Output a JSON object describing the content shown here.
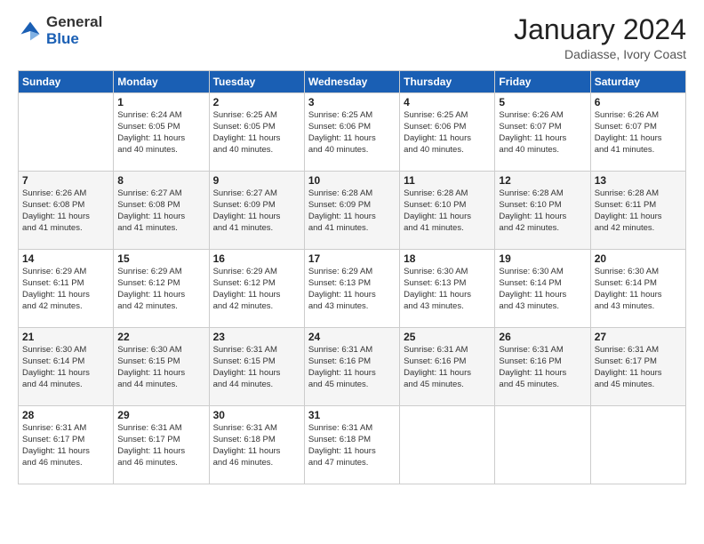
{
  "logo": {
    "general": "General",
    "blue": "Blue"
  },
  "title": "January 2024",
  "location": "Dadiasse, Ivory Coast",
  "days_header": [
    "Sunday",
    "Monday",
    "Tuesday",
    "Wednesday",
    "Thursday",
    "Friday",
    "Saturday"
  ],
  "weeks": [
    [
      {
        "day": "",
        "info": ""
      },
      {
        "day": "1",
        "info": "Sunrise: 6:24 AM\nSunset: 6:05 PM\nDaylight: 11 hours\nand 40 minutes."
      },
      {
        "day": "2",
        "info": "Sunrise: 6:25 AM\nSunset: 6:05 PM\nDaylight: 11 hours\nand 40 minutes."
      },
      {
        "day": "3",
        "info": "Sunrise: 6:25 AM\nSunset: 6:06 PM\nDaylight: 11 hours\nand 40 minutes."
      },
      {
        "day": "4",
        "info": "Sunrise: 6:25 AM\nSunset: 6:06 PM\nDaylight: 11 hours\nand 40 minutes."
      },
      {
        "day": "5",
        "info": "Sunrise: 6:26 AM\nSunset: 6:07 PM\nDaylight: 11 hours\nand 40 minutes."
      },
      {
        "day": "6",
        "info": "Sunrise: 6:26 AM\nSunset: 6:07 PM\nDaylight: 11 hours\nand 41 minutes."
      }
    ],
    [
      {
        "day": "7",
        "info": "Sunrise: 6:26 AM\nSunset: 6:08 PM\nDaylight: 11 hours\nand 41 minutes."
      },
      {
        "day": "8",
        "info": "Sunrise: 6:27 AM\nSunset: 6:08 PM\nDaylight: 11 hours\nand 41 minutes."
      },
      {
        "day": "9",
        "info": "Sunrise: 6:27 AM\nSunset: 6:09 PM\nDaylight: 11 hours\nand 41 minutes."
      },
      {
        "day": "10",
        "info": "Sunrise: 6:28 AM\nSunset: 6:09 PM\nDaylight: 11 hours\nand 41 minutes."
      },
      {
        "day": "11",
        "info": "Sunrise: 6:28 AM\nSunset: 6:10 PM\nDaylight: 11 hours\nand 41 minutes."
      },
      {
        "day": "12",
        "info": "Sunrise: 6:28 AM\nSunset: 6:10 PM\nDaylight: 11 hours\nand 42 minutes."
      },
      {
        "day": "13",
        "info": "Sunrise: 6:28 AM\nSunset: 6:11 PM\nDaylight: 11 hours\nand 42 minutes."
      }
    ],
    [
      {
        "day": "14",
        "info": "Sunrise: 6:29 AM\nSunset: 6:11 PM\nDaylight: 11 hours\nand 42 minutes."
      },
      {
        "day": "15",
        "info": "Sunrise: 6:29 AM\nSunset: 6:12 PM\nDaylight: 11 hours\nand 42 minutes."
      },
      {
        "day": "16",
        "info": "Sunrise: 6:29 AM\nSunset: 6:12 PM\nDaylight: 11 hours\nand 42 minutes."
      },
      {
        "day": "17",
        "info": "Sunrise: 6:29 AM\nSunset: 6:13 PM\nDaylight: 11 hours\nand 43 minutes."
      },
      {
        "day": "18",
        "info": "Sunrise: 6:30 AM\nSunset: 6:13 PM\nDaylight: 11 hours\nand 43 minutes."
      },
      {
        "day": "19",
        "info": "Sunrise: 6:30 AM\nSunset: 6:14 PM\nDaylight: 11 hours\nand 43 minutes."
      },
      {
        "day": "20",
        "info": "Sunrise: 6:30 AM\nSunset: 6:14 PM\nDaylight: 11 hours\nand 43 minutes."
      }
    ],
    [
      {
        "day": "21",
        "info": "Sunrise: 6:30 AM\nSunset: 6:14 PM\nDaylight: 11 hours\nand 44 minutes."
      },
      {
        "day": "22",
        "info": "Sunrise: 6:30 AM\nSunset: 6:15 PM\nDaylight: 11 hours\nand 44 minutes."
      },
      {
        "day": "23",
        "info": "Sunrise: 6:31 AM\nSunset: 6:15 PM\nDaylight: 11 hours\nand 44 minutes."
      },
      {
        "day": "24",
        "info": "Sunrise: 6:31 AM\nSunset: 6:16 PM\nDaylight: 11 hours\nand 45 minutes."
      },
      {
        "day": "25",
        "info": "Sunrise: 6:31 AM\nSunset: 6:16 PM\nDaylight: 11 hours\nand 45 minutes."
      },
      {
        "day": "26",
        "info": "Sunrise: 6:31 AM\nSunset: 6:16 PM\nDaylight: 11 hours\nand 45 minutes."
      },
      {
        "day": "27",
        "info": "Sunrise: 6:31 AM\nSunset: 6:17 PM\nDaylight: 11 hours\nand 45 minutes."
      }
    ],
    [
      {
        "day": "28",
        "info": "Sunrise: 6:31 AM\nSunset: 6:17 PM\nDaylight: 11 hours\nand 46 minutes."
      },
      {
        "day": "29",
        "info": "Sunrise: 6:31 AM\nSunset: 6:17 PM\nDaylight: 11 hours\nand 46 minutes."
      },
      {
        "day": "30",
        "info": "Sunrise: 6:31 AM\nSunset: 6:18 PM\nDaylight: 11 hours\nand 46 minutes."
      },
      {
        "day": "31",
        "info": "Sunrise: 6:31 AM\nSunset: 6:18 PM\nDaylight: 11 hours\nand 47 minutes."
      },
      {
        "day": "",
        "info": ""
      },
      {
        "day": "",
        "info": ""
      },
      {
        "day": "",
        "info": ""
      }
    ]
  ]
}
